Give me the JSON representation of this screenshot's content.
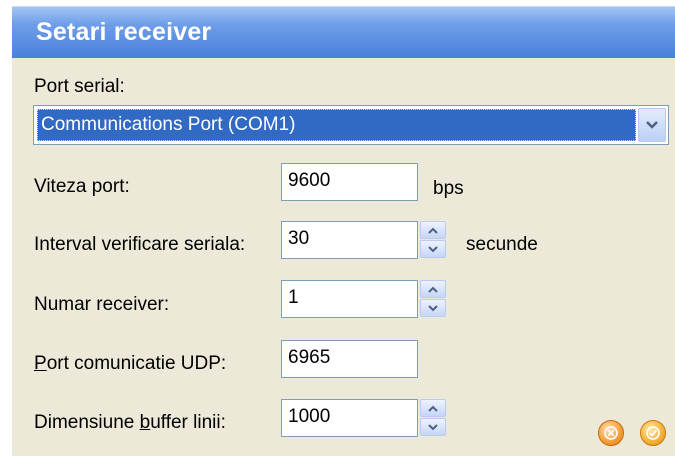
{
  "window": {
    "title": "Setari receiver"
  },
  "form": {
    "port_serial_label": "Port serial:",
    "port_serial_value": "Communications Port (COM1)",
    "viteza_label": "Viteza port:",
    "viteza_value": "9600",
    "viteza_unit": "bps",
    "interval_label": "Interval verificare seriala:",
    "interval_value": "30",
    "interval_unit": "secunde",
    "numar_label": "Numar receiver:",
    "numar_value": "1",
    "udp_label_accel": "P",
    "udp_label_rest": "ort comunicatie UDP:",
    "udp_value": "6965",
    "buffer_label_pre": "Dimensiune ",
    "buffer_label_accel": "b",
    "buffer_label_post": "uffer linii:",
    "buffer_value": "1000"
  },
  "icons": {
    "dropdown": "chevron-down-icon",
    "spin_up": "triangle-up-icon",
    "spin_down": "triangle-down-icon",
    "cancel": "close-circle-icon",
    "ok": "check-circle-icon"
  },
  "colors": {
    "title_gradient_top": "#a5c6f4",
    "title_gradient_bottom": "#4a80dc",
    "panel_bg": "#ece9d8",
    "selection": "#316ac5",
    "button_orange": "#f6a13d"
  }
}
